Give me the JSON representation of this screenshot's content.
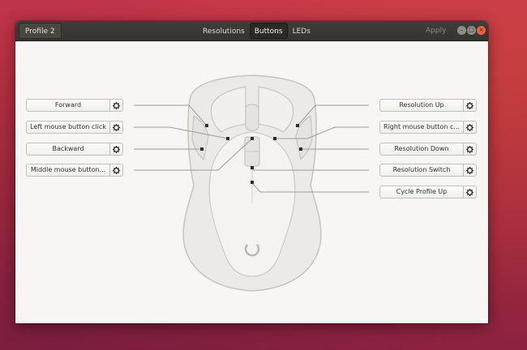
{
  "window": {
    "profile_label": "Profile 2",
    "tabs": [
      {
        "label": "Resolutions",
        "active": false
      },
      {
        "label": "Buttons",
        "active": true
      },
      {
        "label": "LEDs",
        "active": false
      }
    ],
    "apply_label": "Apply",
    "controls": [
      "minimize-icon",
      "maximize-icon",
      "close-icon"
    ],
    "close_color": "#e9643a"
  },
  "left_mappings": [
    {
      "label": "Forward"
    },
    {
      "label": "Left mouse button click"
    },
    {
      "label": "Backward"
    },
    {
      "label": "Middle mouse button..."
    }
  ],
  "right_mappings": [
    {
      "label": "Resolution Up"
    },
    {
      "label": "Right mouse button c..."
    },
    {
      "label": "Resolution Down"
    },
    {
      "label": "Resolution Switch"
    },
    {
      "label": "Cycle Profile Up"
    }
  ],
  "mouse_diagram": {
    "icon": "mouse-outline",
    "accent": "#c9c7c2"
  }
}
